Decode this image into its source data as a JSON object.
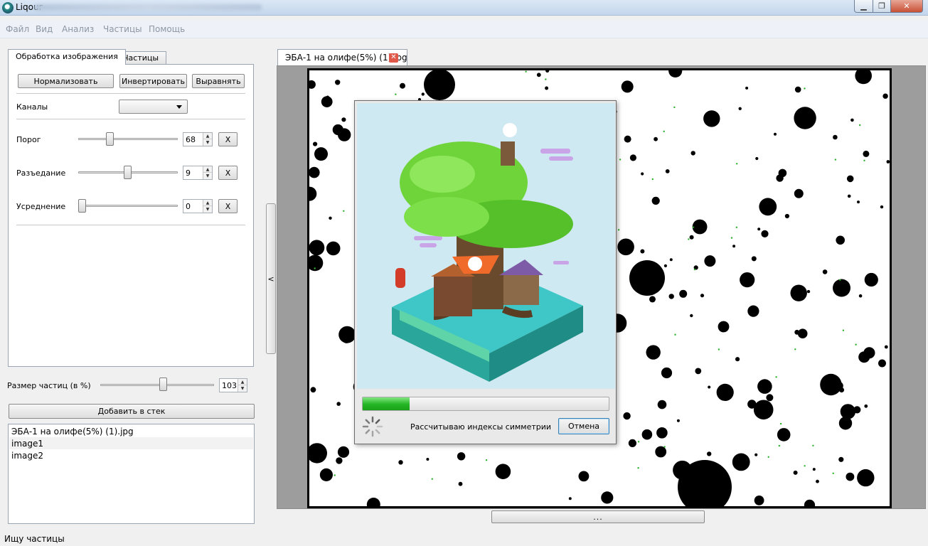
{
  "app": {
    "title": "Liqour"
  },
  "window_controls": {
    "minimize": "▁",
    "maximize": "❐",
    "close": "✕"
  },
  "menu": [
    "Файл",
    "Вид",
    "Анализ",
    "Частицы",
    "Помощь"
  ],
  "left_tabs": {
    "processing": "Обработка изображения",
    "particles": "Частицы"
  },
  "toolbar": {
    "normalize": "Нормализовать",
    "invert": "Инвертировать",
    "align": "Выравнять"
  },
  "channels": {
    "label": "Каналы",
    "value": ""
  },
  "sliders": [
    {
      "label": "Порог",
      "value": "68",
      "level": 0.28,
      "reset": "X"
    },
    {
      "label": "Разъедание",
      "value": "9",
      "level": 0.46,
      "reset": "X"
    },
    {
      "label": "Усреднение",
      "value": "0",
      "level": 0.0,
      "reset": "X"
    }
  ],
  "particle_size": {
    "label": "Размер частиц (в %)",
    "value": "103",
    "level": 0.52
  },
  "add_to_stack": "Добавить в стек",
  "file_list": [
    "ЭБА-1 на олифе(5%) (1).jpg",
    "image1",
    "image2"
  ],
  "collapse_handle": "<",
  "document": {
    "tab_title": "ЭБА-1 на олифе(5%) (1).jpg",
    "close_icon": "✕"
  },
  "viewer": {
    "bottom_button": "..."
  },
  "dialog": {
    "status": "Рассчитываю индексы симметрии",
    "cancel": "Отмена",
    "progress": 0.19
  },
  "status_bar": {
    "text": "Ищу частицы"
  },
  "colors": {
    "accent": "#2bb02b",
    "dialog_sky": "#cfe9f2",
    "particle": "#000000",
    "close_red": "#e0584a"
  },
  "icons": {
    "app": "app-logo-icon",
    "spinner": "busy-spinner-icon",
    "dropdown": "chevron-down-icon"
  }
}
